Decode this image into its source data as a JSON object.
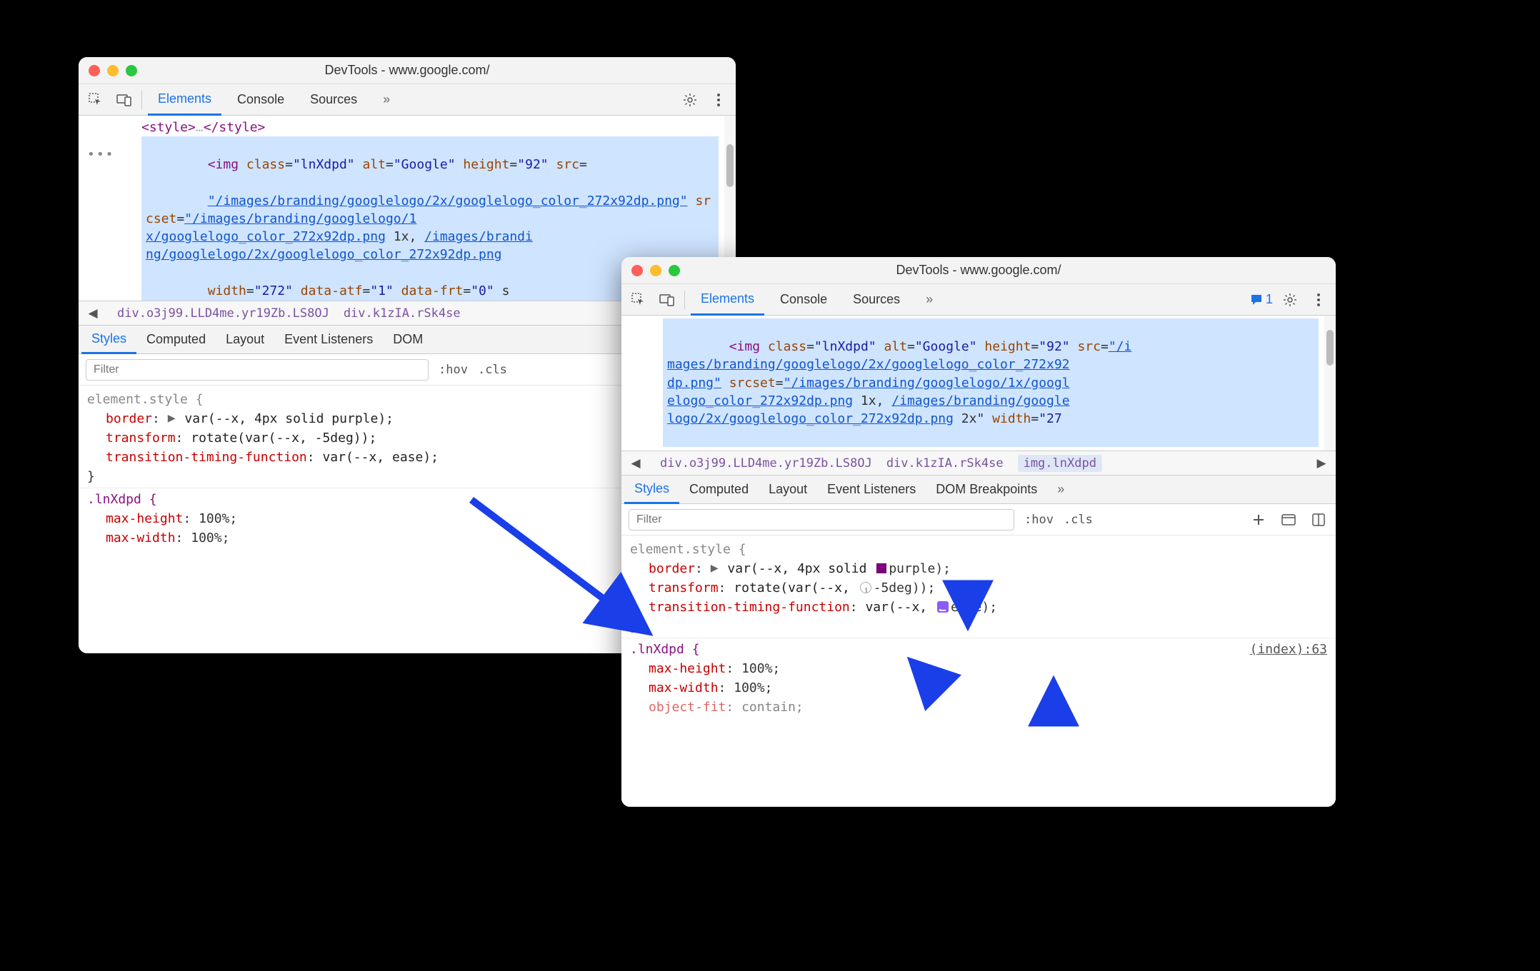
{
  "colors": {
    "accent": "#1a73e8",
    "arrow": "#1a3ee8"
  },
  "win1": {
    "title": "DevTools - www.google.com/",
    "tabs": {
      "active": "Elements",
      "items": [
        "Elements",
        "Console",
        "Sources"
      ],
      "overflow": "»"
    },
    "dom": {
      "style_close": "<style>…</style>",
      "img_open": "<img class=\"lnXdpd\" alt=\"Google\" height=\"92\" src=",
      "img_src": "\"/images/branding/googlelogo/2x/googlelogo_color_272x92dp.png\"",
      "srcset_label": " srcset=",
      "srcset1": "\"/images/branding/googlelogo/1x/googlelogo_color_272x92dp.png",
      "srcset_mid": " 1x, ",
      "srcset2": "/images/branding/googlelogo/2x/googlelogo_color_272x92dp.png",
      "img_tail": "width=\"272\" data-atf=\"1\" data-frt=\"0\" s",
      "inline_style": "border: var(--x, 4px solid purple);"
    },
    "breadcrumb": {
      "nav_prev": "◀",
      "items": [
        "div.o3j99.LLD4me.yr19Zb.LS8OJ",
        "div.k1zIA.rSk4se"
      ]
    },
    "subtabs": {
      "active": "Styles",
      "items": [
        "Styles",
        "Computed",
        "Layout",
        "Event Listeners"
      ],
      "last_partial": "DOM"
    },
    "filter": {
      "placeholder": "Filter",
      "hov": ":hov",
      "cls": ".cls"
    },
    "styles": {
      "element_style": {
        "selector": "element.style {",
        "d1_name": "border",
        "d1_rest": "var(--x, 4px solid purple);",
        "d2_name": "transform",
        "d2_rest": "rotate(var(--x, -5deg));",
        "d3_name": "transition-timing-function",
        "d3_rest": "var(--x, ease);",
        "close": "}"
      },
      "lnXdpd": {
        "selector": ".lnXdpd {",
        "d1_name": "max-height",
        "d1_val": "100%;",
        "d2_name": "max-width",
        "d2_val": "100%;",
        "close": "}"
      }
    }
  },
  "win2": {
    "title": "DevTools - www.google.com/",
    "tabs": {
      "active": "Elements",
      "items": [
        "Elements",
        "Console",
        "Sources"
      ],
      "overflow": "»"
    },
    "issue_count": "1",
    "dom": {
      "img_open": "<img class=\"lnXdpd\" alt=\"Google\" height=\"92\" src=",
      "img_src": "\"/images/branding/googlelogo/2x/googlelogo_color_272x92dp.png\"",
      "srcset_label": " srcset=",
      "srcset1": "\"/images/branding/googlelogo/1x/googlelogo_color_272x92dp.png",
      "srcset_mid": " 1x, ",
      "srcset2": "/images/branding/googlelogo/2x/googlelogo_color_272x92dp.png",
      "srcset_tail": " 2x\"",
      "width_tail": " width=\"27"
    },
    "breadcrumb": {
      "nav_prev": "◀",
      "nav_next": "▶",
      "items": [
        "div.o3j99.LLD4me.yr19Zb.LS8OJ",
        "div.k1zIA.rSk4se",
        "img.lnXdpd"
      ],
      "active": "img.lnXdpd"
    },
    "subtabs": {
      "active": "Styles",
      "items": [
        "Styles",
        "Computed",
        "Layout",
        "Event Listeners",
        "DOM Breakpoints"
      ],
      "overflow": "»"
    },
    "filter": {
      "placeholder": "Filter",
      "hov": ":hov",
      "cls": ".cls"
    },
    "styles": {
      "element_style": {
        "selector": "element.style {",
        "d1_name": "border",
        "d1_pre": "var(--x, 4px solid ",
        "d1_color": "purple",
        "d1_post": ");",
        "d2_name": "transform",
        "d2_pre": "rotate(var(--x, ",
        "d2_val": "-5deg",
        "d2_post": "));",
        "d3_name": "transition-timing-function",
        "d3_pre": "var(--x, ",
        "d3_val": "ease",
        "d3_post": ");",
        "close": "}"
      },
      "lnXdpd": {
        "selector": ".lnXdpd {",
        "source": "(index):63",
        "d1_name": "max-height",
        "d1_val": "100%;",
        "d2_name": "max-width",
        "d2_val": "100%;",
        "d3_name": "object-fit",
        "d3_val": "contain;",
        "close": "}"
      }
    }
  }
}
